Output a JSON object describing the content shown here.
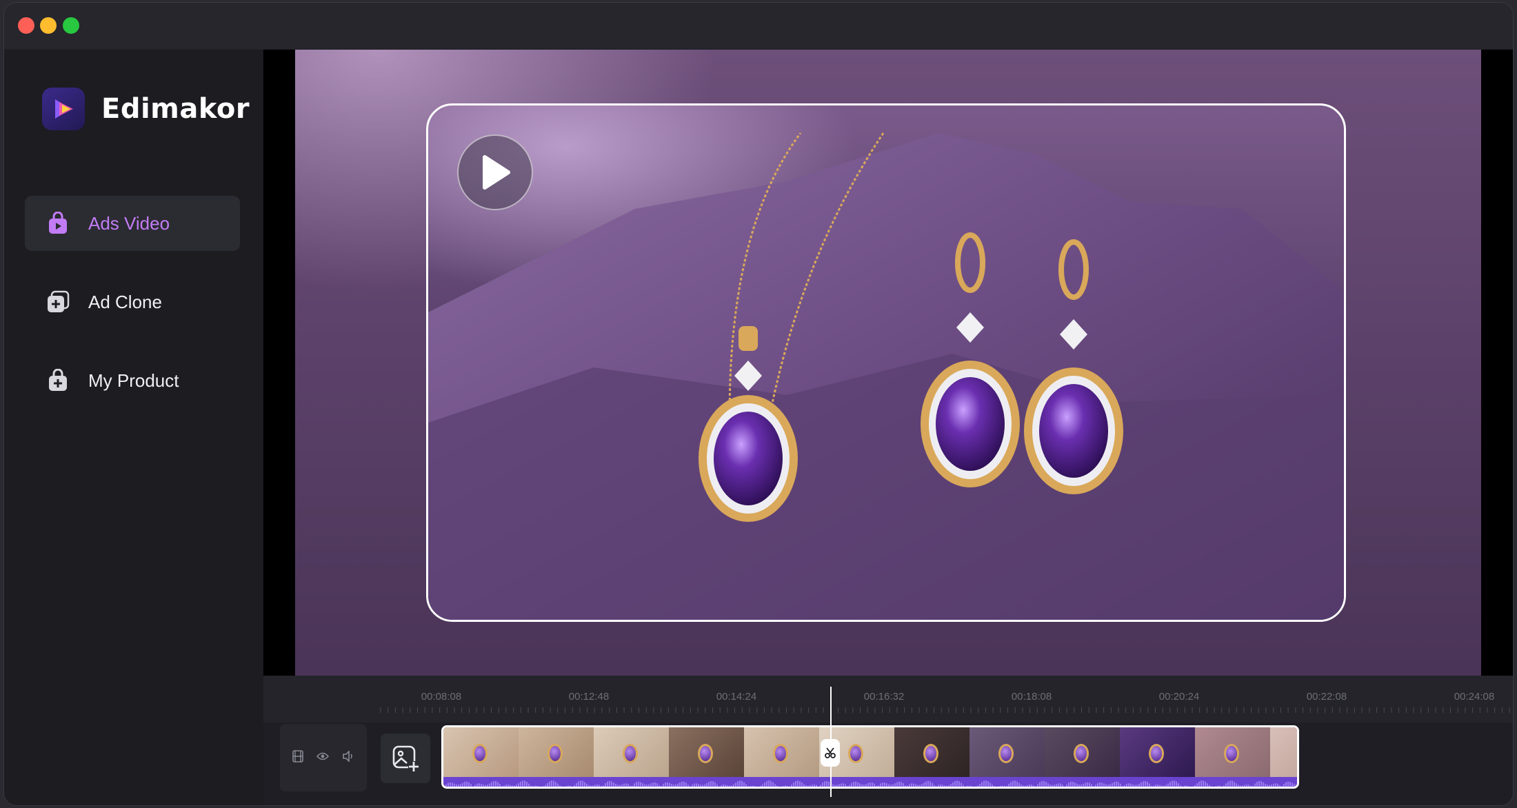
{
  "app": {
    "name": "Edimakor",
    "logo_icon": "edimakor-logo-icon"
  },
  "window_controls": [
    "close",
    "minimize",
    "maximize"
  ],
  "sidebar": {
    "items": [
      {
        "label": "Ads Video",
        "icon": "shopping-bag-play-icon",
        "active": true
      },
      {
        "label": "Ad Clone",
        "icon": "clone-plus-icon",
        "active": false
      },
      {
        "label": "My Product",
        "icon": "shopping-bag-plus-icon",
        "active": false
      }
    ]
  },
  "preview": {
    "play_icon": "play-icon"
  },
  "timeline": {
    "ticks": [
      "00:08:08",
      "00:12:48",
      "00:14:24",
      "00:16:32",
      "00:18:08",
      "00:20:24",
      "00:22:08",
      "00:24:08"
    ],
    "tools": [
      "film-icon",
      "eye-icon",
      "speaker-icon"
    ],
    "add_media_icon": "add-image-icon",
    "split_icon": "scissors-icon",
    "clip_count": 12
  },
  "colors": {
    "accent": "#c27cf5",
    "audio_track": "#6a44d0",
    "background": "#1b1b20"
  }
}
